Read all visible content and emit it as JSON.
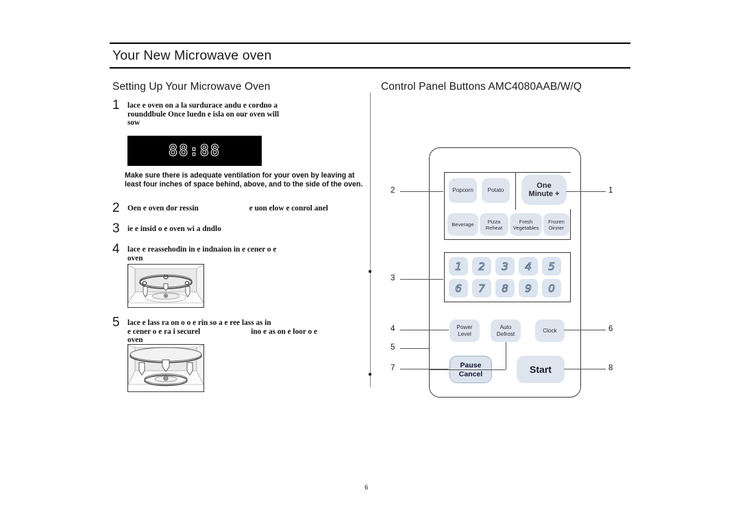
{
  "page": {
    "title": "Your New Microwave oven",
    "number": "6"
  },
  "left_column": {
    "heading": "Setting Up Your Microwave Oven",
    "steps": [
      {
        "num": "1",
        "lines": [
          "lace e oven on a la surdurace andu e cordno a",
          "rounddbule  Once luedn e isla on our oven will",
          "sow"
        ]
      },
      {
        "num": "2",
        "lines_pre": "Oen e oven dor  ressin",
        "lines_post": "e uon elow e conrol anel"
      },
      {
        "num": "3",
        "lines": [
          "ie e insid o e oven wi a dndlo"
        ]
      },
      {
        "num": "4",
        "lines": [
          "lace e reassehodin in e indnaion in e cener o e",
          "oven"
        ]
      },
      {
        "num": "5",
        "line1": "lace e lass ra on o o e rin so a e ree lass as in",
        "line2_pre": "e cener o e ra i securel",
        "line2_post": "ino e as on e loor o e",
        "line3": "oven"
      }
    ],
    "display": {
      "value": "88:88",
      "label": "oven-display"
    },
    "ventilation_note": "Make sure there is adequate ventilation for your oven by leaving at least four inches of space behind, above, and to the side of the oven."
  },
  "right_column": {
    "heading": "Control Panel Buttons AMC4080AAB/W/Q",
    "buttons": {
      "popcorn": "Popcorn",
      "potato": "Potato",
      "one_minute_l1": "One",
      "one_minute_l2": "Minute +",
      "beverage": "Beverage",
      "pizza_l1": "Pizza",
      "pizza_l2": "Reheat",
      "fresh_l1": "Fresh",
      "fresh_l2": "Vegetables",
      "frozen_l1": "Frozen",
      "frozen_l2": "Dinner",
      "power_l1": "Power",
      "power_l2": "Level",
      "defrost_l1": "Auto",
      "defrost_l2": "Defrost",
      "clock": "Clock",
      "pause_l1": "Pause",
      "pause_l2": "Cancel",
      "start": "Start"
    },
    "keypad": [
      "1",
      "2",
      "3",
      "4",
      "5",
      "6",
      "7",
      "8",
      "9",
      "0"
    ],
    "callouts": {
      "c1": "1",
      "c2": "2",
      "c3": "3",
      "c4": "4",
      "c5": "5",
      "c6": "6",
      "c7": "7",
      "c8": "8"
    }
  },
  "colors": {
    "button_fill": "#dee5ee",
    "key_fill": "#dbe4ef",
    "panel_border": "#3a3a3a",
    "text": "#1a1a1a"
  }
}
